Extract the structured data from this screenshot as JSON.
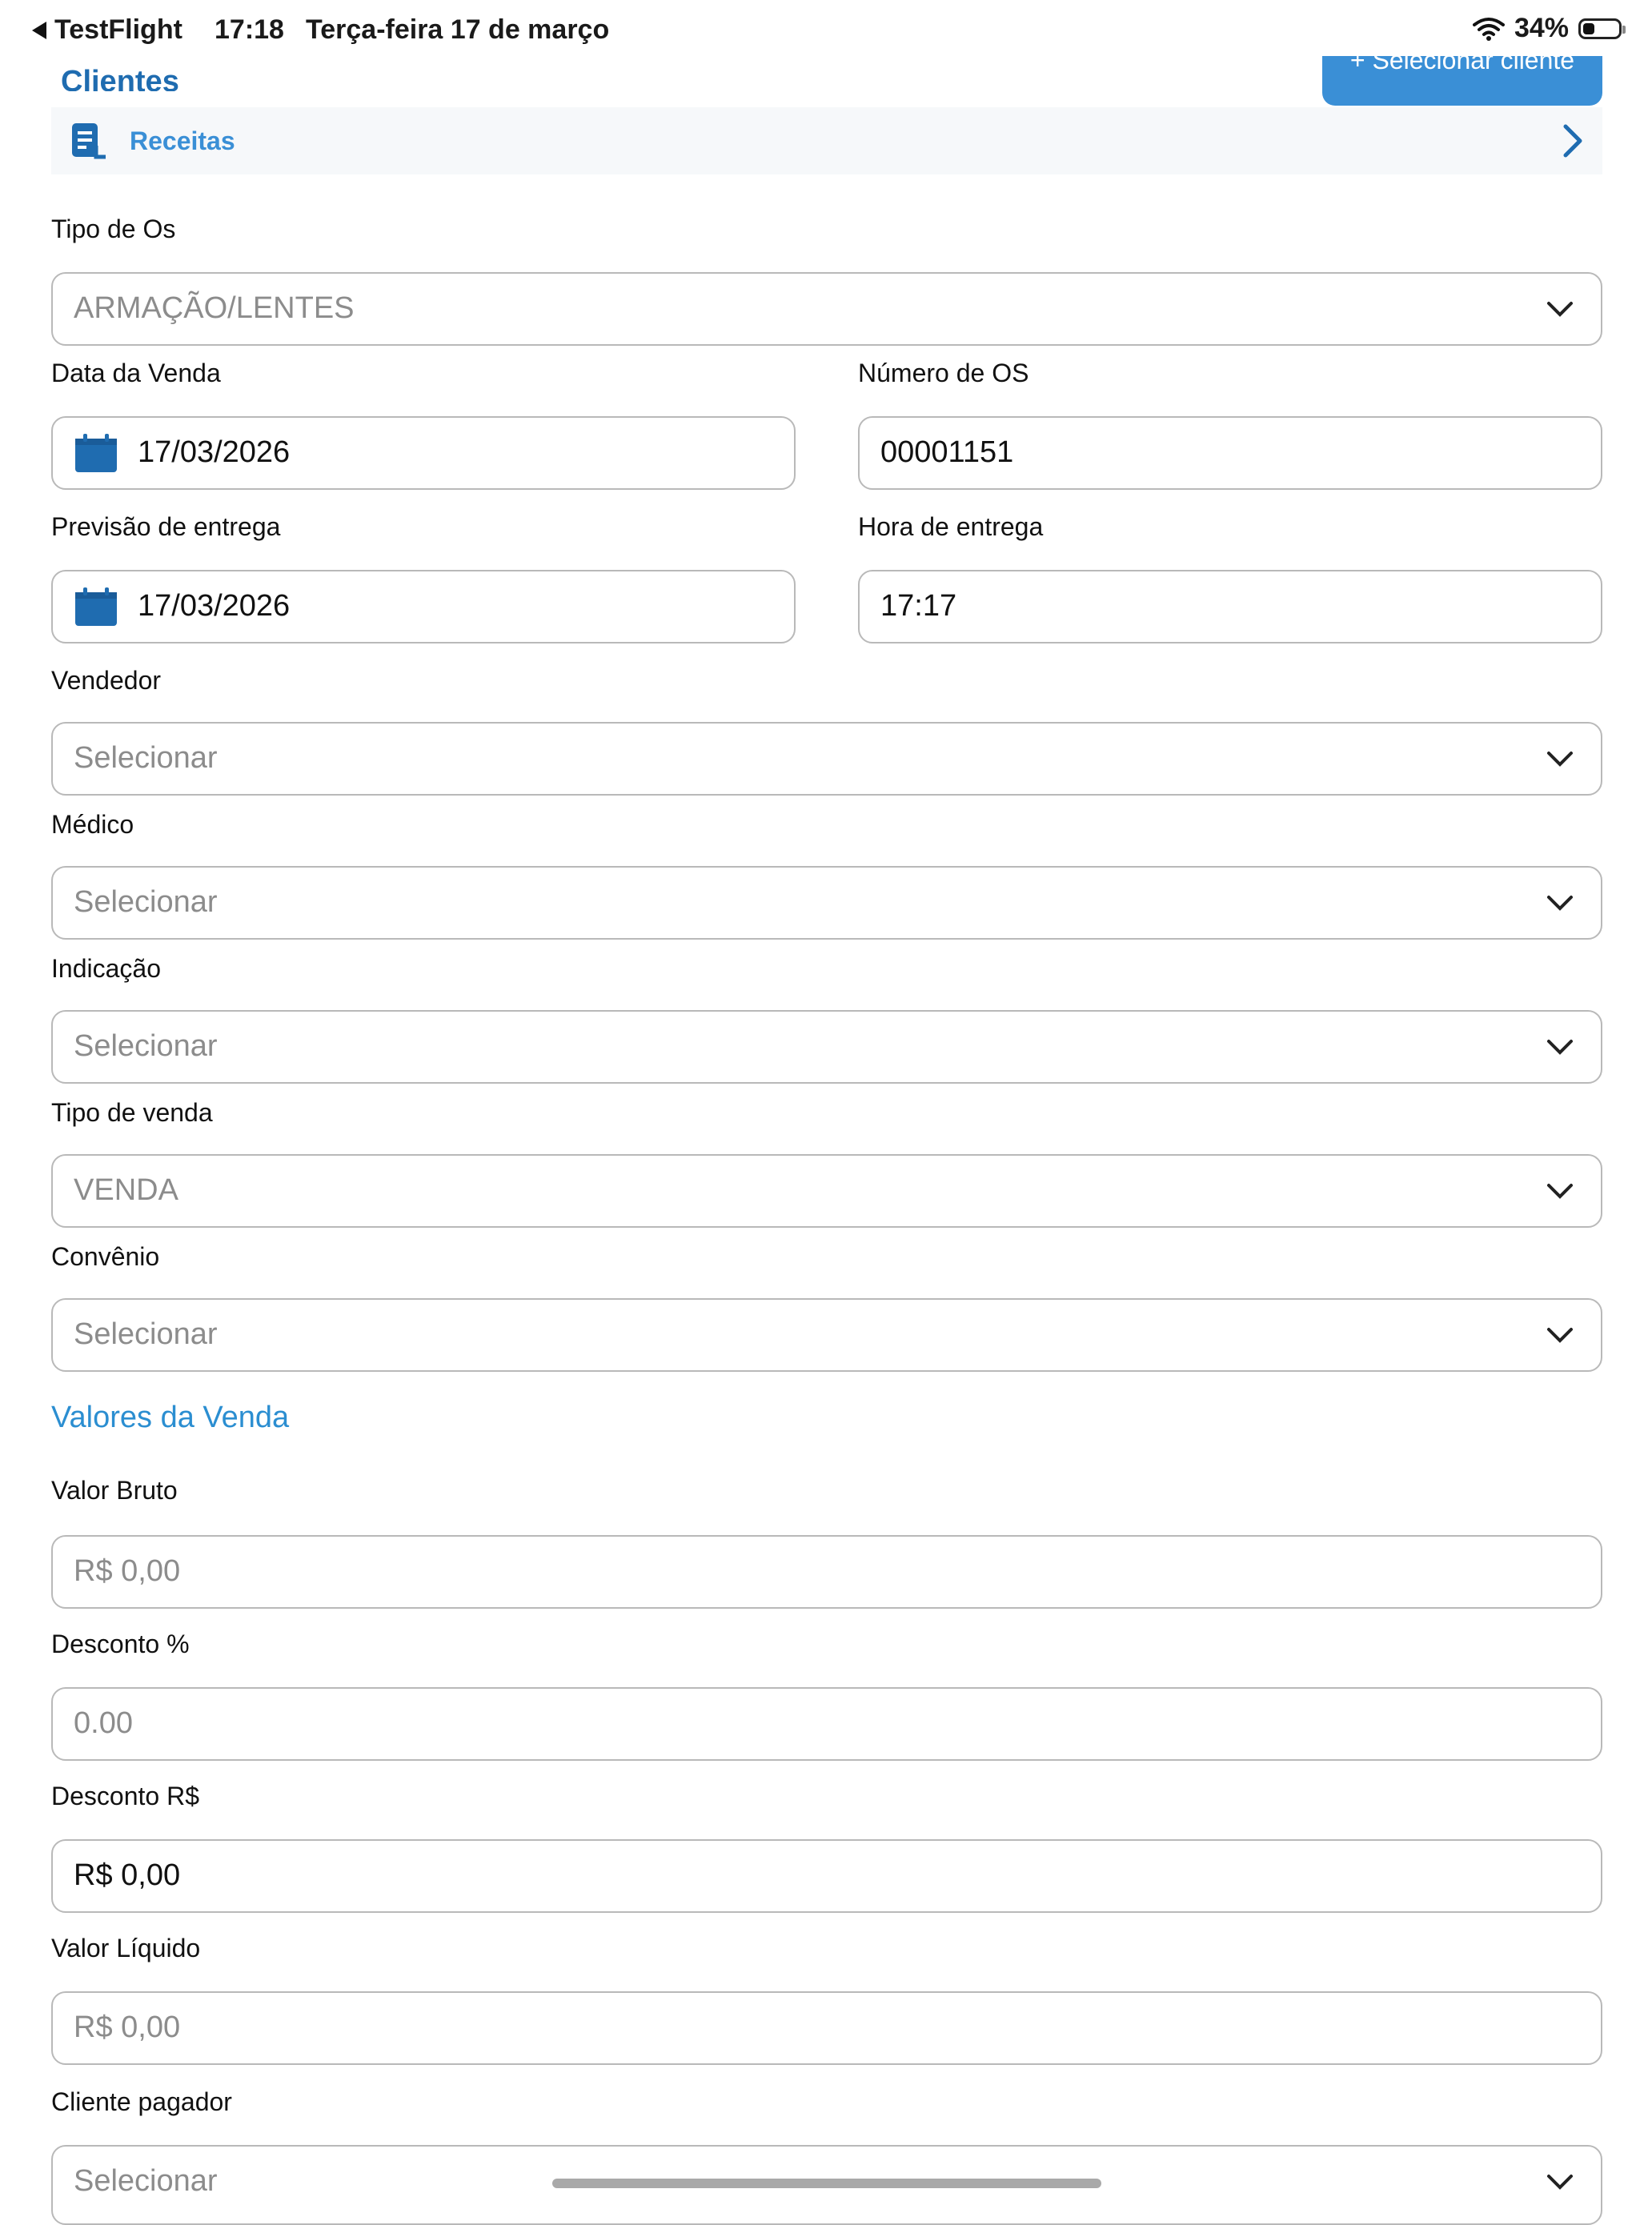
{
  "status_bar": {
    "back_app": "TestFlight",
    "time": "17:18",
    "date": "Terça-feira 17 de março",
    "battery": "34%",
    "battery_level": 0.34
  },
  "header": {
    "section_title": "Clientes",
    "select_client_button": "+ Selecionar cliente"
  },
  "receitas": {
    "label": "Receitas"
  },
  "form": {
    "tipo_os": {
      "label": "Tipo de Os",
      "value": "ARMAÇÃO/LENTES"
    },
    "data_venda": {
      "label": "Data da Venda",
      "value": "17/03/2026"
    },
    "numero_os": {
      "label": "Número de OS",
      "value": "00001151"
    },
    "previsao_entrega": {
      "label": "Previsão de entrega",
      "value": "17/03/2026"
    },
    "hora_entrega": {
      "label": "Hora de entrega",
      "value": "17:17"
    },
    "vendedor": {
      "label": "Vendedor",
      "placeholder": "Selecionar"
    },
    "medico": {
      "label": "Médico",
      "placeholder": "Selecionar"
    },
    "indicacao": {
      "label": "Indicação",
      "placeholder": "Selecionar"
    },
    "tipo_venda": {
      "label": "Tipo de venda",
      "value": "VENDA"
    },
    "convenio": {
      "label": "Convênio",
      "placeholder": "Selecionar"
    }
  },
  "valores": {
    "title": "Valores da Venda",
    "valor_bruto": {
      "label": "Valor Bruto",
      "value": "R$ 0,00"
    },
    "desconto_pct": {
      "label": "Desconto %",
      "value": "0.00"
    },
    "desconto_rs": {
      "label": "Desconto R$",
      "value": "R$ 0,00"
    },
    "valor_liquido": {
      "label": "Valor Líquido",
      "value": "R$ 0,00"
    },
    "cliente_pagador": {
      "label": "Cliente pagador",
      "placeholder": "Selecionar"
    }
  },
  "colors": {
    "accent": "#3a8fd6",
    "title_blue": "#1f6cb0",
    "border": "#b9b9b9",
    "placeholder": "#8c8c8c"
  }
}
